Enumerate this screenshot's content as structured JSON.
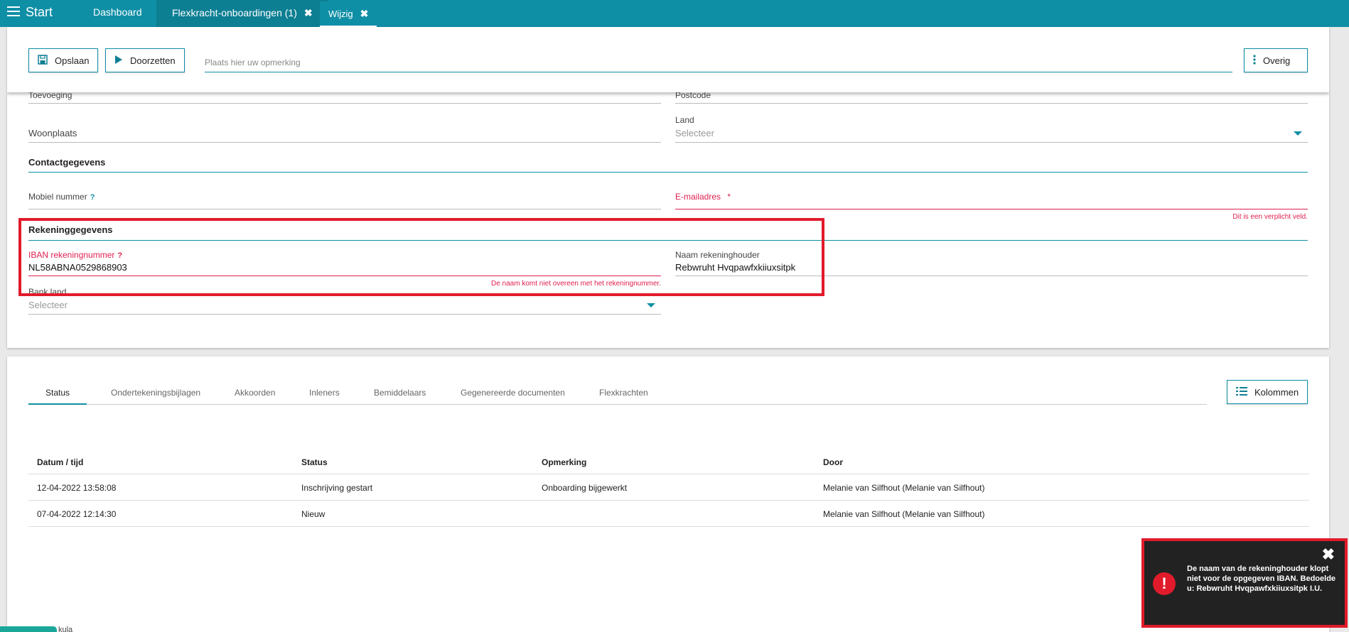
{
  "topbar": {
    "start": "Start",
    "tabs": [
      {
        "label": "Dashboard"
      },
      {
        "label": "Flexkracht-onboardingen (1)",
        "close": "✖"
      },
      {
        "label": "Wijzig",
        "close": "✖"
      }
    ]
  },
  "actions": {
    "save": "Opslaan",
    "forward": "Doorzetten",
    "remark_placeholder": "Plaats hier uw opmerking",
    "more": "Overig"
  },
  "form": {
    "toevoeging": "Toevoeging",
    "postcode": "Postcode",
    "woonplaats": "Woonplaats",
    "land_label": "Land",
    "land_placeholder": "Selecteer",
    "contact_section": "Contactgegevens",
    "mobiel_label": "Mobiel nummer",
    "email_label": "E-mailadres",
    "email_required": "*",
    "email_error": "Dit is een verplicht veld.",
    "bank_section": "Rekeninggegevens",
    "iban_label": "IBAN rekeningnummer",
    "iban_value": "NL58ABNA0529868903",
    "iban_error": "De naam komt niet overeen met het rekeningnummer.",
    "holder_label": "Naam rekeninghouder",
    "holder_value": "Rebwruht Hvqpawfxkiiuxsitpk",
    "bankland_label": "Bank land",
    "bankland_placeholder": "Selecteer",
    "help": "?"
  },
  "tabs": {
    "items": [
      "Status",
      "Ondertekeningsbijlagen",
      "Akkoorden",
      "Inleners",
      "Bemiddelaars",
      "Gegenereerde documenten",
      "Flexkrachten"
    ],
    "columns_button": "Kolommen"
  },
  "table": {
    "headers": [
      "Datum / tijd",
      "Status",
      "Opmerking",
      "Door"
    ],
    "rows": [
      [
        "12-04-2022 13:58:08",
        "Inschrijving gestart",
        "Onboarding bijgewerkt",
        "Melanie van Silfhout (Melanie van Silfhout)"
      ],
      [
        "07-04-2022 12:14:30",
        "Nieuw",
        "",
        "Melanie van Silfhout (Melanie van Silfhout)"
      ]
    ]
  },
  "toast": {
    "message": "De naam van de rekeninghouder klopt niet voor de opgegeven IBAN. Bedoelde u: Rebwruht Hvqpawfxkiiuxsitpk I.U.",
    "close": "✖",
    "icon": "!"
  },
  "footer": {
    "text": "kula"
  },
  "colors": {
    "accent": "#0f8fa6",
    "error": "#e02050",
    "highlight": "#e11b2b"
  }
}
